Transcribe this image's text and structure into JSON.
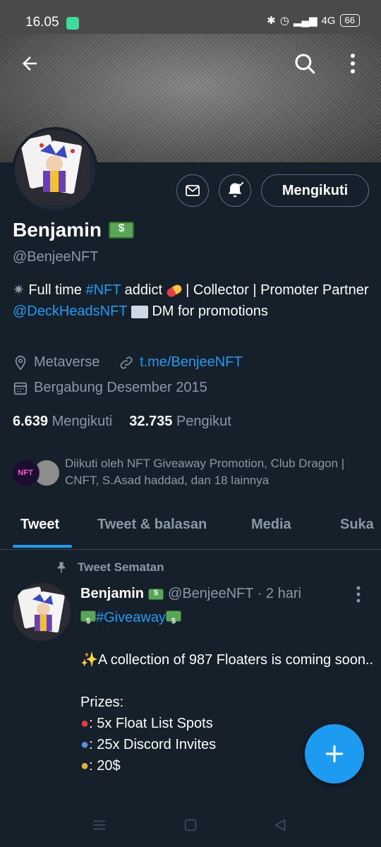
{
  "status_bar": {
    "time": "16.05",
    "network": "4G",
    "battery": "66"
  },
  "profile": {
    "name": "Benjamin",
    "handle": "@BenjeeNFT",
    "follow_label": "Mengikuti",
    "bio": {
      "p1": "Full time ",
      "hashtag": "#NFT",
      "p2": " addict ",
      "p3": " | Collector | Promoter  Partner ",
      "mention": "@DeckHeadsNFT",
      "p4": " DM for promotions"
    },
    "location": "Metaverse",
    "website": "t.me/BenjeeNFT",
    "joined": "Bergabung Desember 2015",
    "following_count": "6.639",
    "following_label": "Mengikuti",
    "followers_count": "32.735",
    "followers_label": "Pengikut",
    "followed_by": "Diikuti oleh NFT Giveaway Promotion, Club Dragon | CNFT, S.Asad haddad, dan 18 lainnya",
    "mini_avatar_text": "NFT"
  },
  "tabs": [
    "Tweet",
    "Tweet & balasan",
    "Media",
    "Suka"
  ],
  "tweet": {
    "pinned_label": "Tweet Sematan",
    "name": "Benjamin",
    "handle_time": "@BenjeeNFT · 2 hari",
    "hashtag": "#Giveaway",
    "line1": "A collection of 987 Floaters is coming soon..",
    "prizes_label": "Prizes:",
    "prize1": ": 5x Float List Spots",
    "prize2": ": 25x Discord Invites",
    "prize3": ": 20$"
  },
  "colors": {
    "background": "#15202b",
    "accent": "#1d9bf0",
    "muted": "#8b98a5",
    "border": "#38444d"
  },
  "icons": [
    "back-arrow-icon",
    "search-icon",
    "more-vertical-icon",
    "mail-icon",
    "bell-icon",
    "location-icon",
    "link-icon",
    "calendar-icon",
    "pin-icon",
    "plus-icon",
    "menu-icon",
    "home-square-icon",
    "back-triangle-icon"
  ]
}
